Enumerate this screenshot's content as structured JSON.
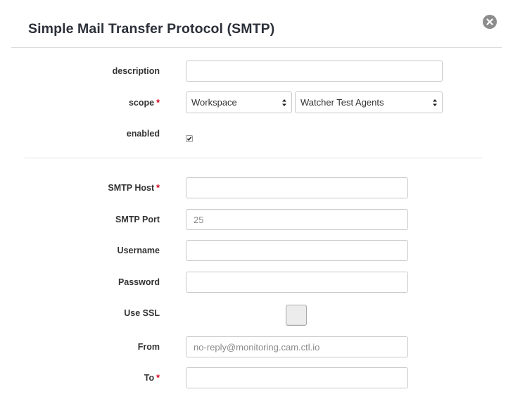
{
  "dialog": {
    "title": "Simple Mail Transfer Protocol (SMTP)",
    "close_icon": "close-circle-icon"
  },
  "form": {
    "description": {
      "label": "description",
      "value": ""
    },
    "scope": {
      "label": "scope",
      "required_mark": "*",
      "type_value": "Workspace",
      "target_value": "Watcher Test Agents"
    },
    "enabled": {
      "label": "enabled",
      "checked": true
    },
    "smtp_host": {
      "label": "SMTP Host",
      "required_mark": "*",
      "value": ""
    },
    "smtp_port": {
      "label": "SMTP Port",
      "placeholder": "25"
    },
    "username": {
      "label": "Username",
      "value": ""
    },
    "password": {
      "label": "Password",
      "value": ""
    },
    "use_ssl": {
      "label": "Use SSL",
      "checked": false
    },
    "from": {
      "label": "From",
      "placeholder": "no-reply@monitoring.cam.ctl.io"
    },
    "to": {
      "label": "To",
      "required_mark": "*",
      "value": ""
    }
  },
  "colors": {
    "required": "#d0021b",
    "close_button": "#8c8c8c",
    "border": "#c8c8c8"
  }
}
